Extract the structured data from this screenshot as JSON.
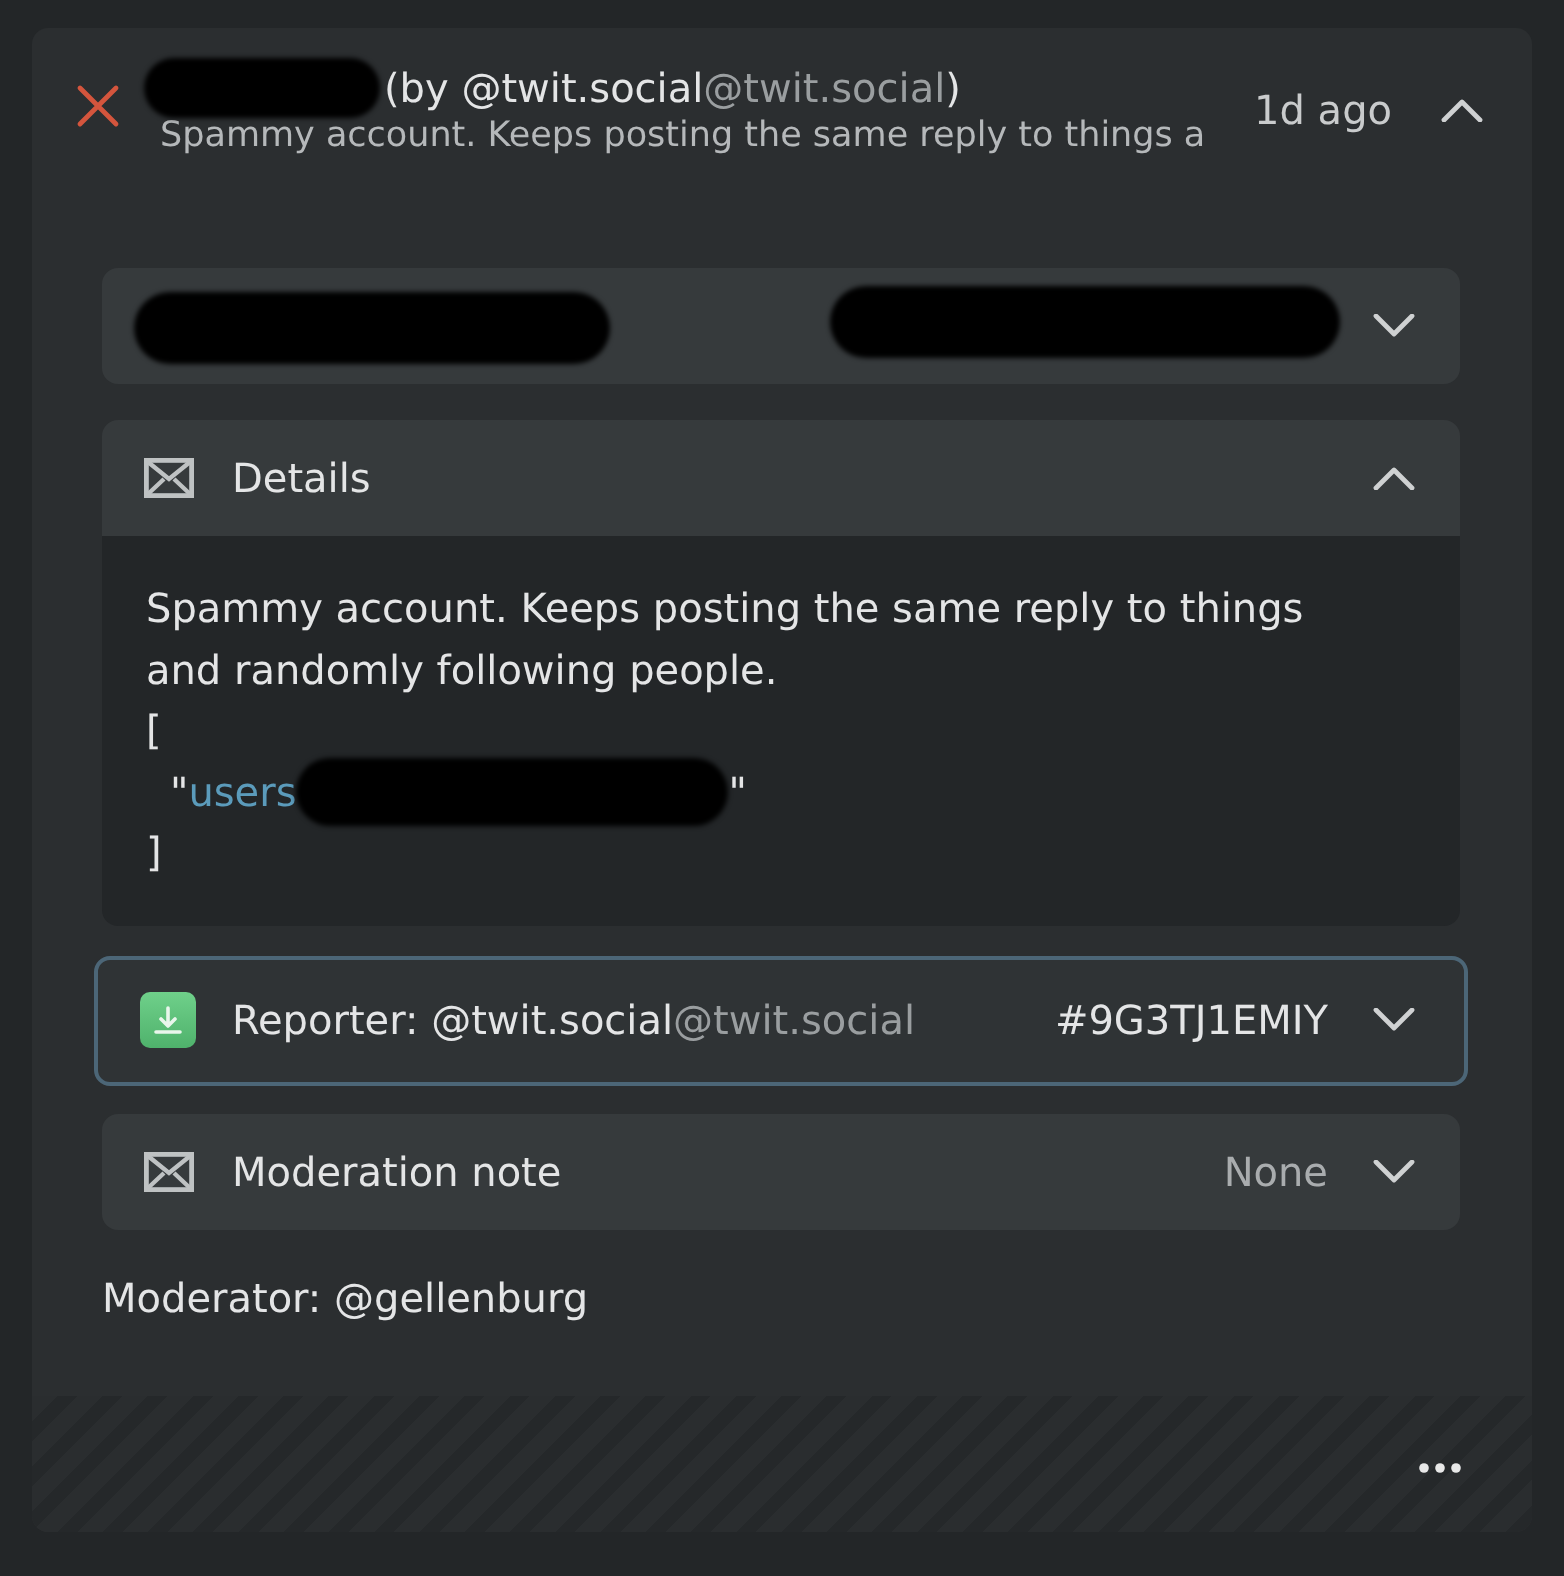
{
  "report": {
    "title": "(by @twit.social",
    "title_domain": "@twit.social",
    "title_end": ")",
    "summary": "Spammy account. Keeps posting the same reply to things a",
    "time": "1d ago",
    "expanded": true
  },
  "target_panel": {
    "expanded": false
  },
  "details": {
    "label": "Details",
    "expanded": true,
    "text": "Spammy account. Keeps posting the same reply to things and randomly following people.",
    "open_bracket": "[",
    "entries": [
      {
        "quote_open": "\"",
        "link": "users",
        "quote_close": "\""
      }
    ],
    "close_bracket": "]"
  },
  "reporter": {
    "label": "Reporter: @twit.social",
    "domain": "@twit.social",
    "id": "#9G3TJ1EMIY",
    "focused": true,
    "expanded": false
  },
  "moderation_note": {
    "label": "Moderation note",
    "value": "None",
    "expanded": false
  },
  "moderator": "Moderator: @gellenburg"
}
